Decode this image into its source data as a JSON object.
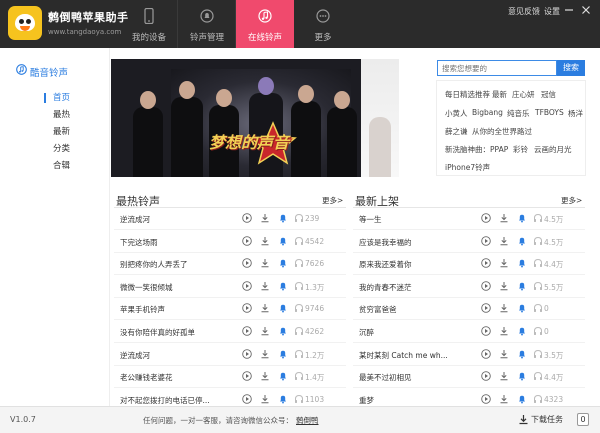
{
  "app": {
    "name": "鹩倒鸭苹果助手",
    "url": "www.tangdaoya.com"
  },
  "nav": {
    "tabs": [
      {
        "label": "我的设备",
        "icon": "phone-icon"
      },
      {
        "label": "铃声管理",
        "icon": "bell-circle-icon"
      },
      {
        "label": "在线铃声",
        "icon": "music-note-icon",
        "active": true
      },
      {
        "label": "更多",
        "icon": "more-icon"
      }
    ],
    "feedback": "意见反馈",
    "settings": "设置"
  },
  "sidebar": {
    "title": "酷音铃声",
    "items": [
      "首页",
      "最热",
      "最新",
      "分类",
      "合辑"
    ],
    "active_index": 0
  },
  "banner": {
    "slogan": "梦想的声音"
  },
  "search": {
    "placeholder": "搜索您想要的",
    "button": "搜索"
  },
  "tags": {
    "row1": [
      "每日精选推荐",
      "最新",
      "庄心妍",
      "冠信"
    ],
    "row2": [
      "小黄人",
      "Bigbang",
      "纯音乐",
      "TFBOYS",
      "杨洋"
    ],
    "row3": [
      "薛之谦",
      "从你的全世界路过"
    ],
    "row4": [
      "新洗脑神曲：PPAP",
      "彩铃",
      "云画的月光"
    ],
    "row5": [
      "iPhone7铃声"
    ]
  },
  "hot": {
    "title": "最热铃声",
    "more": "更多>",
    "items": [
      {
        "name": "逆流成河",
        "count": "239"
      },
      {
        "name": "下完这场雨",
        "count": "4542"
      },
      {
        "name": "别把疼你的人弄丢了",
        "count": "7626"
      },
      {
        "name": "微微一笑很倾城",
        "count": "1.3万"
      },
      {
        "name": "苹果手机铃声",
        "count": "9746"
      },
      {
        "name": "没有你陪伴真的好孤单",
        "count": "4262"
      },
      {
        "name": "逆流成河",
        "count": "1.2万"
      },
      {
        "name": "老公赚钱老婆花",
        "count": "1.4万"
      },
      {
        "name": "对不起您拨打的电话已停...",
        "count": "1103"
      }
    ]
  },
  "latest": {
    "title": "最新上架",
    "more": "更多>",
    "items": [
      {
        "name": "等一生",
        "count": "4.5万"
      },
      {
        "name": "应该是我幸福的",
        "count": "4.5万"
      },
      {
        "name": "原来我还爱着你",
        "count": "4.4万"
      },
      {
        "name": "我的青春不迷茫",
        "count": "5.5万"
      },
      {
        "name": "贫穷富爸爸",
        "count": "0"
      },
      {
        "name": "沉醉",
        "count": "0"
      },
      {
        "name": "某时某刻 Catch me wh...",
        "count": "3.5万"
      },
      {
        "name": "最美不过初相见",
        "count": "4.4万"
      },
      {
        "name": "重梦",
        "count": "4323"
      }
    ]
  },
  "status": {
    "version": "V1.0.7",
    "help": "任何问题，一对一客服，请咨询微信公众号：",
    "account": "鹩倒鸭",
    "download": "下载任务",
    "download_count": "0"
  },
  "colors": {
    "accent": "#2b7de0",
    "active_tab": "#f04a6d",
    "topbar": "#2b2b2b"
  }
}
